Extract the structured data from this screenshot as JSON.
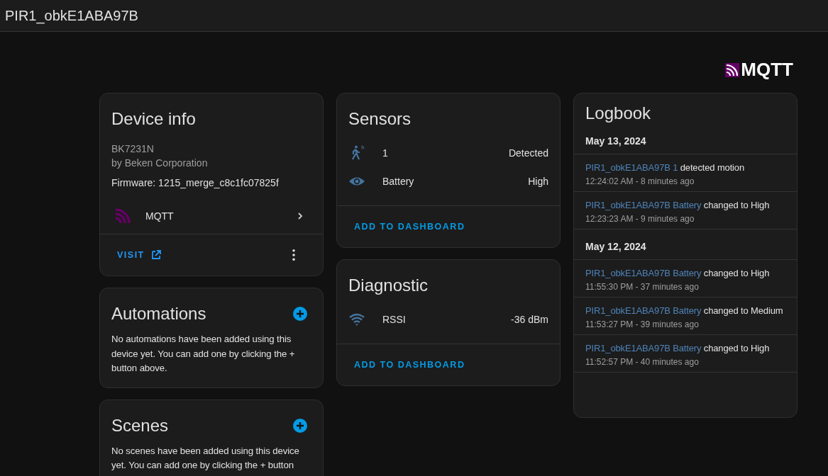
{
  "header": {
    "title": "PIR1_obkE1ABA97B"
  },
  "logo": {
    "text": "MQTT"
  },
  "device_info": {
    "title": "Device info",
    "model": "BK7231N",
    "manufacturer": "by Beken Corporation",
    "firmware": "Firmware: 1215_merge_c8c1fc07825f",
    "integration": "MQTT",
    "visit": "VISIT"
  },
  "automations": {
    "title": "Automations",
    "text": "No automations have been added using this device yet. You can add one by clicking the + button above."
  },
  "scenes": {
    "title": "Scenes",
    "text": "No scenes have been added using this device yet. You can add one by clicking the + button"
  },
  "sensors": {
    "title": "Sensors",
    "rows": [
      {
        "kind": "motion",
        "name": "1",
        "value": "Detected"
      },
      {
        "kind": "state",
        "name": "Battery",
        "value": "High"
      }
    ],
    "action": "ADD TO DASHBOARD"
  },
  "diagnostic": {
    "title": "Diagnostic",
    "rows": [
      {
        "kind": "signal",
        "name": "RSSI",
        "value": "-36 dBm"
      }
    ],
    "action": "ADD TO DASHBOARD"
  },
  "logbook": {
    "title": "Logbook",
    "groups": [
      {
        "date": "May 13, 2024",
        "entries": [
          {
            "entity": "PIR1_obkE1ABA97B 1",
            "message": "detected motion",
            "time": "12:24:02 AM - 8 minutes ago"
          },
          {
            "entity": "PIR1_obkE1ABA97B Battery",
            "message": "changed to High",
            "time": "12:23:23 AM - 9 minutes ago"
          }
        ]
      },
      {
        "date": "May 12, 2024",
        "entries": [
          {
            "entity": "PIR1_obkE1ABA97B Battery",
            "message": "changed to High",
            "time": "11:55:30 PM - 37 minutes ago"
          },
          {
            "entity": "PIR1_obkE1ABA97B Battery",
            "message": "changed to Medium",
            "time": "11:53:27 PM - 39 minutes ago"
          },
          {
            "entity": "PIR1_obkE1ABA97B Battery",
            "message": "changed to High",
            "time": "11:52:57 PM - 40 minutes ago"
          }
        ]
      }
    ]
  }
}
